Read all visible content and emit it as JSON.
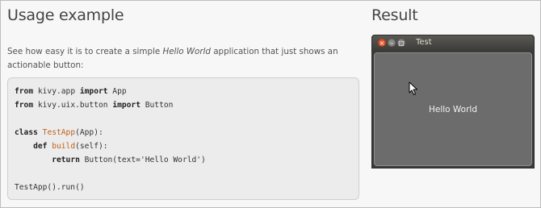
{
  "usage": {
    "heading": "Usage example",
    "intro_before": "See how easy it is to create a simple ",
    "intro_em": "Hello World",
    "intro_after": " application that just shows an actionable button:",
    "code": {
      "line1_kw": "from",
      "line1_mid": " kivy.app ",
      "line1_kw2": "import",
      "line1_end": " App",
      "line2_kw": "from",
      "line2_mid": " kivy.uix.button ",
      "line2_kw2": "import",
      "line2_end": " Button",
      "line3_blank": "",
      "line4_kw": "class",
      "line4_sp": " ",
      "line4_fn": "TestApp",
      "line4_end": "(App):",
      "line5_indent": "    ",
      "line5_kw": "def",
      "line5_sp": " ",
      "line5_fn": "build",
      "line5_end": "(self):",
      "line6_indent": "        ",
      "line6_kw": "return",
      "line6_end": " Button(text='Hello World')",
      "line7_blank": "",
      "line8": "TestApp().run()"
    }
  },
  "result": {
    "heading": "Result",
    "window_title": "Test",
    "close_glyph": "×",
    "min_glyph": "–",
    "max_glyph": "□",
    "button_label": "Hello World"
  },
  "colors": {
    "code_function": "#c0611e",
    "window_close": "#e4582b"
  }
}
